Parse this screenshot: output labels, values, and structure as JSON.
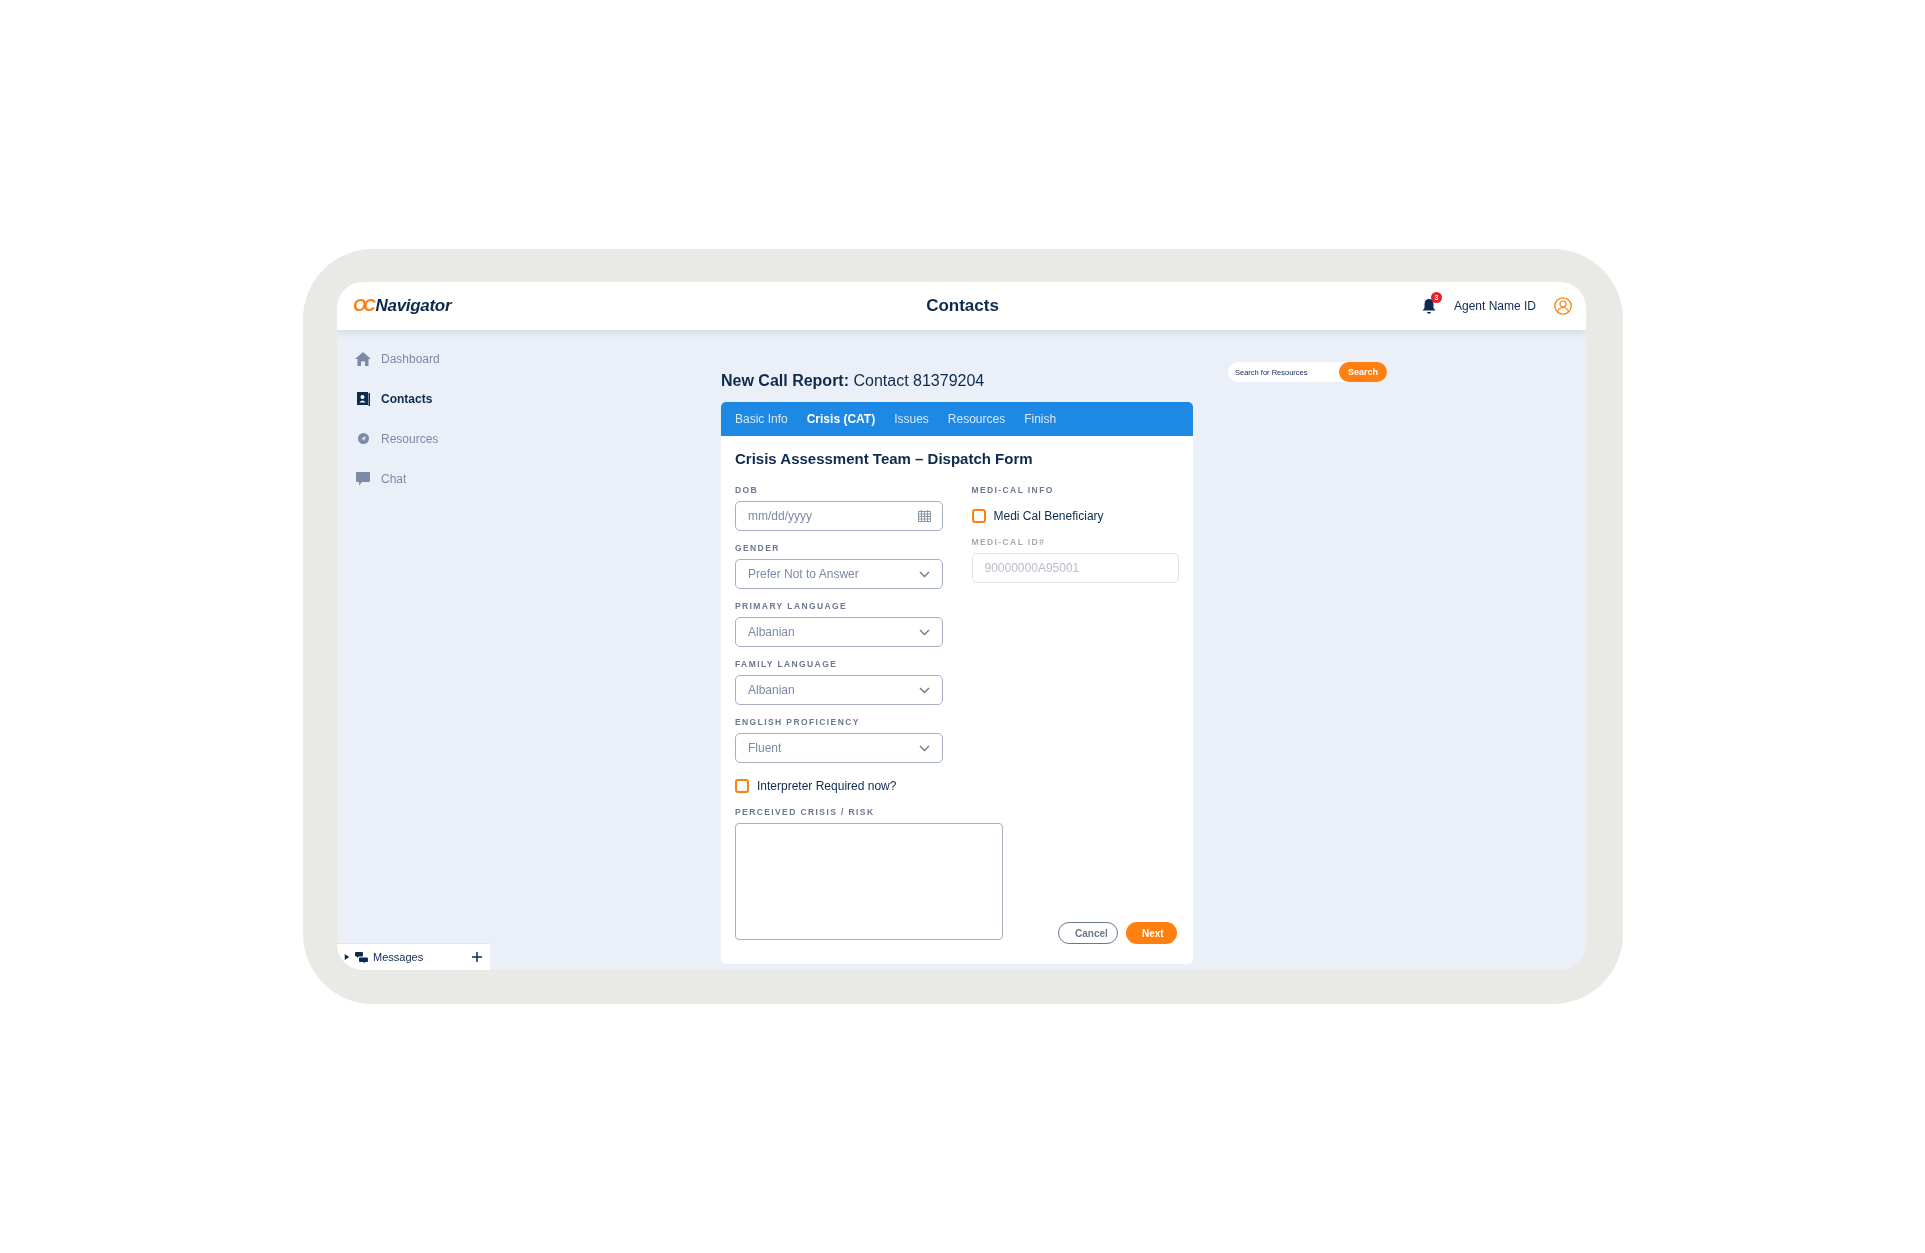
{
  "header": {
    "logo": {
      "mark": "OC",
      "text": "Navigator"
    },
    "title": "Contacts",
    "notification_count": "3",
    "user": "Agent Name ID"
  },
  "sidebar": {
    "items": [
      {
        "label": "Dashboard",
        "selected": false
      },
      {
        "label": "Contacts",
        "selected": true
      },
      {
        "label": "Resources",
        "selected": false
      },
      {
        "label": "Chat",
        "selected": false
      }
    ],
    "messages": {
      "label": "Messages",
      "expanded": false
    }
  },
  "page_title": {
    "bold": "New Call Report:",
    "rest": "Contact 81379204"
  },
  "tabs": [
    {
      "label": "Basic Info",
      "selected": false
    },
    {
      "label": "Crisis (CAT)",
      "selected": true
    },
    {
      "label": "Issues",
      "selected": false
    },
    {
      "label": "Resources",
      "selected": false
    },
    {
      "label": "Finish",
      "selected": false
    }
  ],
  "form": {
    "title": "Crisis Assessment Team – Dispatch Form",
    "fields": [
      {
        "kind": "date",
        "label": "DOB",
        "placeholder": "mm/dd/yyyy"
      },
      {
        "kind": "select",
        "label": "GENDER",
        "value": "Prefer Not to Answer"
      },
      {
        "kind": "select",
        "label": "PRIMARY LANGUAGE",
        "value": "Albanian"
      },
      {
        "kind": "select",
        "label": "FAMILY LANGUAGE",
        "value": "Albanian"
      },
      {
        "kind": "select",
        "label": "ENGLISH PROFICIENCY",
        "value": "Fluent"
      },
      {
        "kind": "checkbox",
        "label": "Interpreter Required now?",
        "checked": false
      },
      {
        "kind": "textarea",
        "label": "PERCEIVED CRISIS / RISK"
      }
    ],
    "side_fields": [
      {
        "kind": "heading",
        "label": "MEDI-CAL INFO"
      },
      {
        "kind": "checkbox",
        "label": "Medi Cal Beneficiary",
        "checked": false
      },
      {
        "kind": "text",
        "label": "MEDI-CAL ID#",
        "placeholder": "90000000A95001",
        "disabled": true
      }
    ],
    "buttons": [
      {
        "kind": "secondary",
        "label": "Cancel"
      },
      {
        "kind": "primary",
        "label": "Next"
      }
    ]
  },
  "search": {
    "placeholder": "Search for Resources",
    "button": "Search"
  }
}
